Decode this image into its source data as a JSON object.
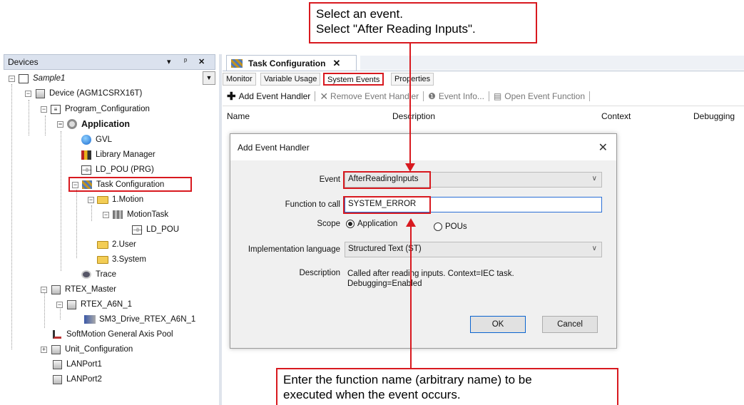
{
  "devices_panel": {
    "title": "Devices",
    "pin_label": "▾ p ✕",
    "project": "Sample1",
    "tree": [
      {
        "label": "Sample1"
      },
      {
        "label": "Device (AGM1CSRX16T)"
      },
      {
        "label": "Program_Configuration"
      },
      {
        "label": "Application"
      },
      {
        "label": "GVL"
      },
      {
        "label": "Library Manager"
      },
      {
        "label": "LD_POU (PRG)"
      },
      {
        "label": "Task Configuration"
      },
      {
        "label": "1.Motion"
      },
      {
        "label": "MotionTask"
      },
      {
        "label": "LD_POU"
      },
      {
        "label": "2.User"
      },
      {
        "label": "3.System"
      },
      {
        "label": "Trace"
      },
      {
        "label": "RTEX_Master"
      },
      {
        "label": "RTEX_A6N_1"
      },
      {
        "label": "SM3_Drive_RTEX_A6N_1"
      },
      {
        "label": "SoftMotion General Axis Pool"
      },
      {
        "label": "Unit_Configuration"
      },
      {
        "label": "LANPort1"
      },
      {
        "label": "LANPort2"
      }
    ]
  },
  "editor": {
    "tab_title": "Task Configuration",
    "subtabs": [
      "Monitor",
      "Variable Usage",
      "System Events",
      "Properties"
    ],
    "toolbar": {
      "add": "Add Event Handler",
      "remove": "Remove Event Handler",
      "info": "Event Info...",
      "open": "Open Event Function"
    },
    "columns": [
      "Name",
      "Description",
      "Context",
      "Debugging"
    ]
  },
  "dialog": {
    "title": "Add Event Handler",
    "event_label": "Event",
    "event_value": "AfterReadingInputs",
    "function_label": "Function to call",
    "function_value": "SYSTEM_ERROR",
    "scope_label": "Scope",
    "scope_application": "Application",
    "scope_pous": "POUs",
    "impl_label": "Implementation language",
    "impl_value": "Structured Text (ST)",
    "desc_label": "Description",
    "desc_line1": "Called after reading inputs. Context=IEC task.",
    "desc_line2": "Debugging=Enabled",
    "ok": "OK",
    "cancel": "Cancel"
  },
  "callouts": {
    "top_line1": "Select an event.",
    "top_line2": "Select \"After Reading Inputs\".",
    "bottom_line1": "Enter the function name (arbitrary name) to be",
    "bottom_line2": "executed when the event occurs."
  },
  "colors": {
    "highlight": "#d8191f"
  }
}
